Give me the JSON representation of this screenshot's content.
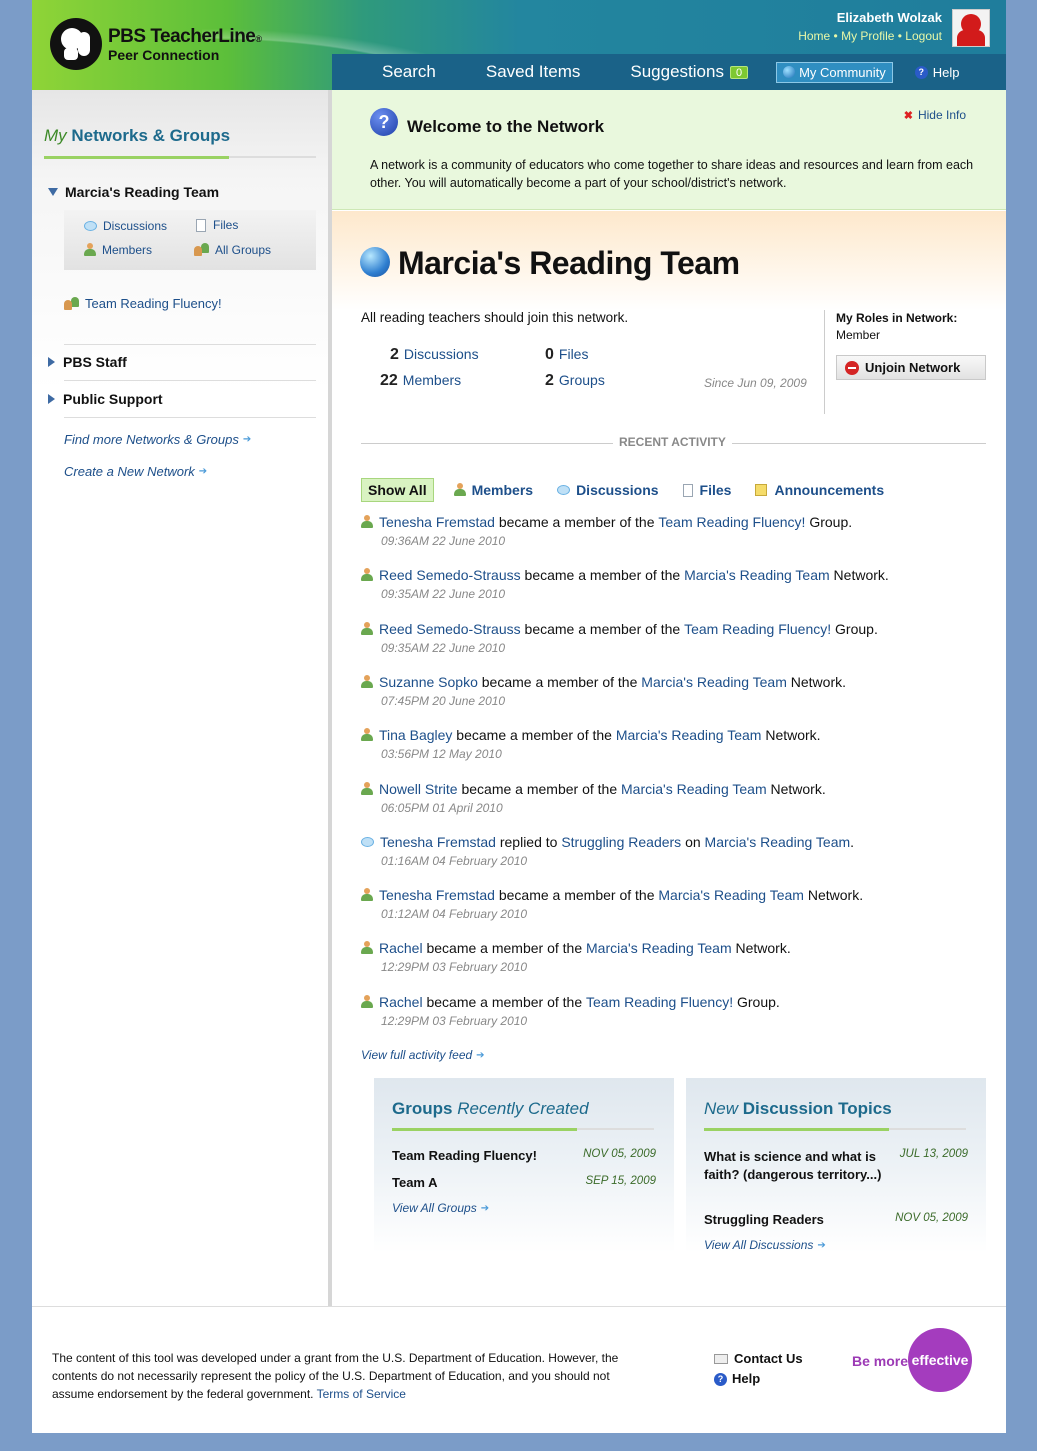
{
  "header": {
    "brand_line1": "PBS TeacherLine",
    "brand_mark": "®",
    "brand_line2": "Peer Connection",
    "user_name": "Elizabeth Wolzak",
    "links": [
      "Home",
      "My Profile",
      "Logout"
    ],
    "nav": {
      "search": "Search",
      "saved": "Saved Items",
      "suggestions": "Suggestions",
      "suggestions_count": "0",
      "community": "My Community",
      "help": "Help"
    }
  },
  "sidebar": {
    "title_my": "My",
    "title_rest": "Networks & Groups",
    "network1": "Marcia's Reading Team",
    "sub": {
      "discussions": "Discussions",
      "files": "Files",
      "members": "Members",
      "all_groups": "All Groups"
    },
    "group": "Team Reading Fluency!",
    "network2": "PBS Staff",
    "network3": "Public Support",
    "find_more": "Find more Networks & Groups",
    "create": "Create a New Network"
  },
  "welcome": {
    "title": "Welcome to the Network",
    "hide": "Hide Info",
    "desc": "A network is a community of educators who come together to share ideas and resources and learn from each other. You will automatically become a part of your school/district's network."
  },
  "network": {
    "title": "Marcia's Reading Team",
    "desc": "All reading teachers should join this network.",
    "discussions_n": "2",
    "discussions_l": "Discussions",
    "files_n": "0",
    "files_l": "Files",
    "members_n": "22",
    "members_l": "Members",
    "groups_n": "2",
    "groups_l": "Groups",
    "since": "Since Jun 09, 2009",
    "roles_label": "My Roles in Network:",
    "role": "Member",
    "unjoin": "Unjoin Network"
  },
  "activity": {
    "heading": "RECENT ACTIVITY",
    "filters": {
      "all": "Show All",
      "members": "Members",
      "discussions": "Discussions",
      "files": "Files",
      "announcements": "Announcements"
    },
    "items": [
      {
        "icon": "person",
        "parts": [
          [
            "l",
            "Tenesha Fremstad"
          ],
          [
            "t",
            " became a member of the "
          ],
          [
            "l",
            "Team Reading Fluency!"
          ],
          [
            "t",
            " Group."
          ]
        ],
        "time": "09:36AM 22 June 2010"
      },
      {
        "icon": "person",
        "parts": [
          [
            "l",
            "Reed Semedo-Strauss"
          ],
          [
            "t",
            " became a member of the "
          ],
          [
            "l",
            "Marcia's Reading Team"
          ],
          [
            "t",
            " Network."
          ]
        ],
        "time": "09:35AM 22 June 2010"
      },
      {
        "icon": "person",
        "parts": [
          [
            "l",
            "Reed Semedo-Strauss"
          ],
          [
            "t",
            " became a member of the "
          ],
          [
            "l",
            "Team Reading Fluency!"
          ],
          [
            "t",
            " Group."
          ]
        ],
        "time": "09:35AM 22 June 2010"
      },
      {
        "icon": "person",
        "parts": [
          [
            "l",
            "Suzanne Sopko"
          ],
          [
            "t",
            " became a member of the "
          ],
          [
            "l",
            "Marcia's Reading Team"
          ],
          [
            "t",
            " Network."
          ]
        ],
        "time": "07:45PM 20 June 2010"
      },
      {
        "icon": "person",
        "parts": [
          [
            "l",
            "Tina Bagley"
          ],
          [
            "t",
            " became a member of the "
          ],
          [
            "l",
            "Marcia's Reading Team"
          ],
          [
            "t",
            " Network."
          ]
        ],
        "time": "03:56PM 12 May 2010"
      },
      {
        "icon": "person",
        "parts": [
          [
            "l",
            "Nowell Strite"
          ],
          [
            "t",
            " became a member of the "
          ],
          [
            "l",
            "Marcia's Reading Team"
          ],
          [
            "t",
            " Network."
          ]
        ],
        "time": "06:05PM 01 April 2010"
      },
      {
        "icon": "bubble",
        "parts": [
          [
            "l",
            "Tenesha Fremstad"
          ],
          [
            "t",
            " replied to "
          ],
          [
            "l",
            "Struggling Readers"
          ],
          [
            "t",
            " on "
          ],
          [
            "l",
            "Marcia's Reading Team"
          ],
          [
            "t",
            "."
          ]
        ],
        "time": "01:16AM 04 February 2010"
      },
      {
        "icon": "person",
        "parts": [
          [
            "l",
            "Tenesha Fremstad"
          ],
          [
            "t",
            " became a member of the "
          ],
          [
            "l",
            "Marcia's Reading Team"
          ],
          [
            "t",
            " Network."
          ]
        ],
        "time": "01:12AM 04 February 2010"
      },
      {
        "icon": "person",
        "parts": [
          [
            "l",
            "Rachel"
          ],
          [
            "t",
            " became a member of the "
          ],
          [
            "l",
            "Marcia's Reading Team"
          ],
          [
            "t",
            " Network."
          ]
        ],
        "time": "12:29PM 03 February 2010"
      },
      {
        "icon": "person",
        "parts": [
          [
            "l",
            "Rachel"
          ],
          [
            "t",
            " became a member of the "
          ],
          [
            "l",
            "Team Reading Fluency!"
          ],
          [
            "t",
            " Group."
          ]
        ],
        "time": "12:29PM 03 February 2010"
      }
    ],
    "view_full": "View full activity feed"
  },
  "groups_box": {
    "title_a": "Groups",
    "title_b": "Recently Created",
    "rows": [
      {
        "name": "Team Reading Fluency!",
        "date": "NOV 05, 2009"
      },
      {
        "name": "Team A",
        "date": "SEP 15, 2009"
      }
    ],
    "view_all": "View All Groups"
  },
  "topics_box": {
    "title_a": "New",
    "title_b": "Discussion Topics",
    "rows": [
      {
        "name": "What is science and what is faith? (dangerous territory...)",
        "date": "JUL 13, 2009"
      },
      {
        "name": "Struggling Readers",
        "date": "NOV 05, 2009"
      }
    ],
    "view_all": "View All Discussions"
  },
  "footer": {
    "text": "The content of this tool was developed under a grant from the U.S. Department of Education. However, the contents do not necessarily represent the policy of the U.S. Department of Education, and you should not assume endorsement by the federal government.",
    "terms": "Terms of Service",
    "contact": "Contact Us",
    "help": "Help",
    "be_more": "Be more",
    "effective": "effective"
  }
}
